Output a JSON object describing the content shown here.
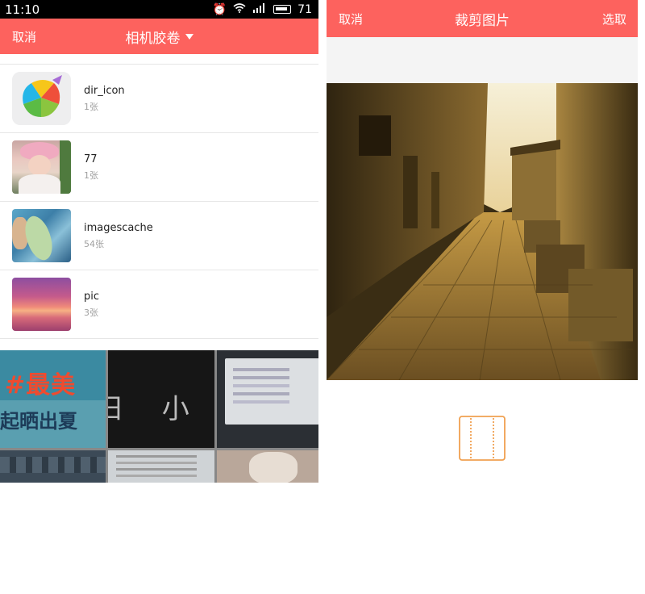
{
  "status_bar": {
    "time": "11:10",
    "battery": "71",
    "icons": [
      "alarm-icon",
      "wifi-icon",
      "signal-icon",
      "battery-icon"
    ]
  },
  "album_picker": {
    "cancel_label": "取消",
    "title": "相机胶卷",
    "albums": [
      {
        "name": "dir_icon",
        "count": "1张"
      },
      {
        "name": "77",
        "count": "1张"
      },
      {
        "name": "imagescache",
        "count": "54张"
      },
      {
        "name": "pic",
        "count": "3张"
      }
    ],
    "grid_text": {
      "cell1_line1": "#最美",
      "cell1_line2": "起晒出夏",
      "cell2_text": "日 小"
    }
  },
  "crop_screen": {
    "cancel_label": "取消",
    "title": "裁剪图片",
    "confirm_label": "选取"
  },
  "colors": {
    "accent": "#fd625e",
    "rotate_icon": "#f0a050"
  }
}
